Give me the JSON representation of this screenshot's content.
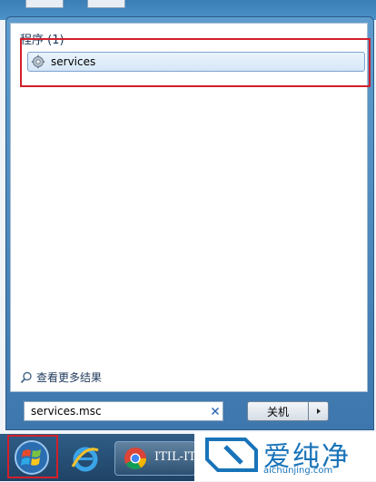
{
  "results": {
    "section_title": "程序 (1)",
    "items": [
      {
        "label": "services",
        "icon": "gear-icon"
      }
    ],
    "see_more": "查看更多结果"
  },
  "search": {
    "value": "services.msc"
  },
  "shutdown": {
    "label": "关机"
  },
  "taskbar": {
    "chrome_task_label": "ITIL-ITS"
  },
  "watermark": {
    "brand": "爱纯净",
    "url": "aichunjing.com"
  },
  "colors": {
    "highlight": "#d21f2a",
    "brand": "#1873b9",
    "taskbar": "#1f4366"
  }
}
